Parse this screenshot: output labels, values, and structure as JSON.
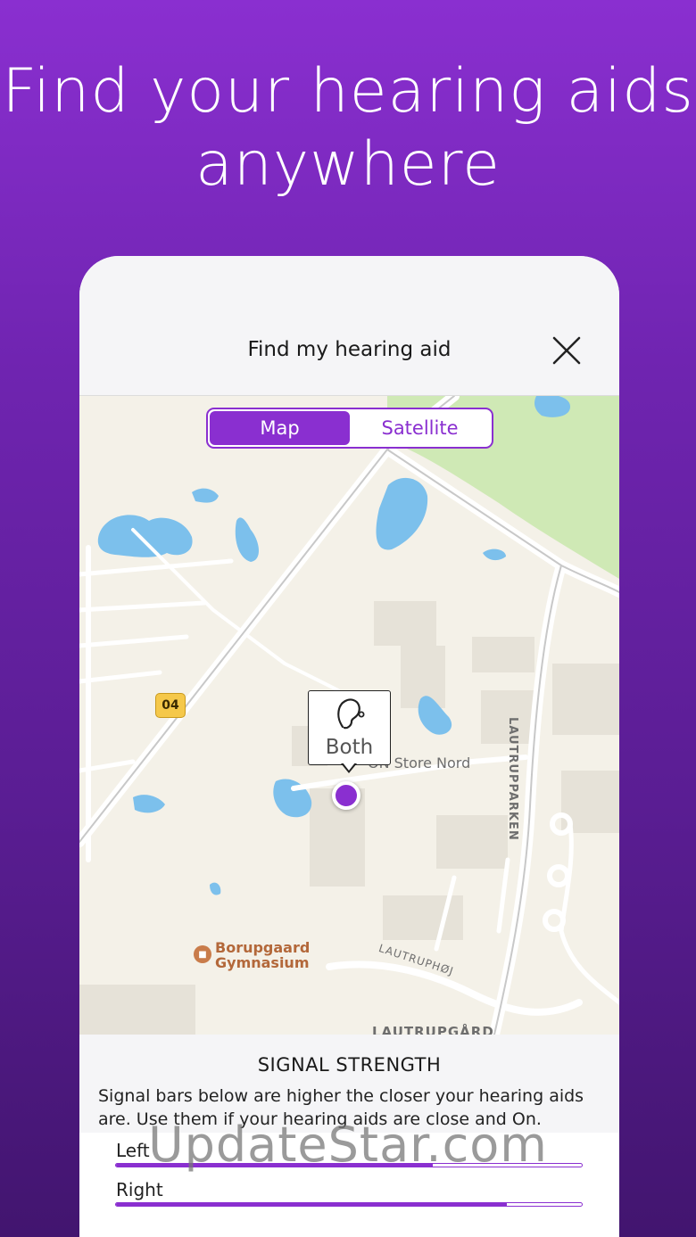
{
  "headline": "Find your hearing aids anywhere",
  "header": {
    "title": "Find my hearing aid",
    "close_icon": "close-icon"
  },
  "map_toggle": {
    "options": [
      "Map",
      "Satellite"
    ],
    "selected": "Map"
  },
  "map": {
    "road_badge": "04",
    "store_label": "ON Store Nord",
    "street_vertical": "LAUTRUPPARKEN",
    "street_lower": "LAUTRUPHØJ",
    "area_label": "LAUTRUPGÅRD",
    "poi_line1": "Borupgaard",
    "poi_line2": "Gymnasium",
    "callout_label": "Both",
    "callout_icon": "ear-icon"
  },
  "signal": {
    "title": "SIGNAL STRENGTH",
    "description": "Signal bars below are higher the closer your hearing aids are. Use them if your hearing aids are close and On.",
    "bars": [
      {
        "label": "Left",
        "level": 0.68
      },
      {
        "label": "Right",
        "level": 0.84
      }
    ]
  },
  "watermark": "UpdateStar.com",
  "colors": {
    "accent": "#8a2fd0",
    "water": "#7cc0ec",
    "park": "#cfe9b5"
  }
}
